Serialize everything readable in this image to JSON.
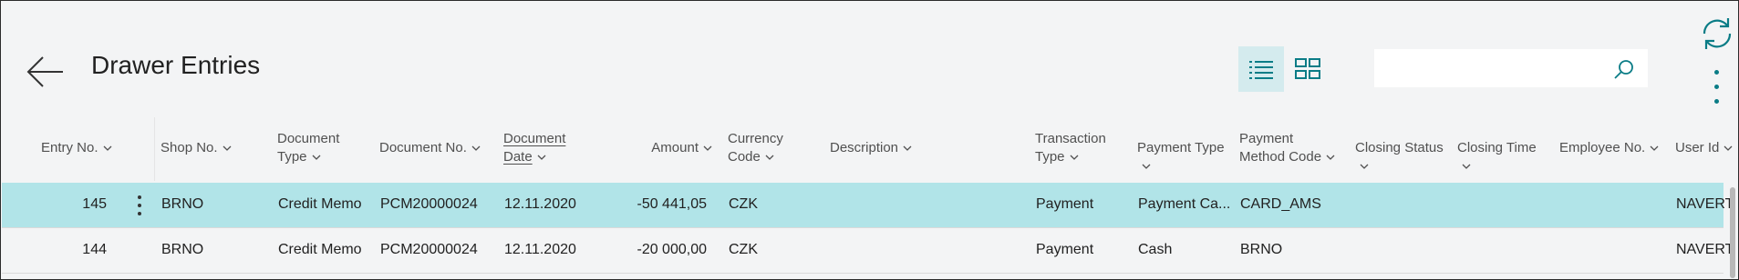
{
  "page": {
    "title": "Drawer Entries"
  },
  "search": {
    "value": "",
    "placeholder": ""
  },
  "columns": [
    {
      "key": "entry_no",
      "line1": "Entry No.",
      "line2": ""
    },
    {
      "key": "shop_no",
      "line1": "Shop No.",
      "line2": ""
    },
    {
      "key": "document_type",
      "line1": "Document",
      "line2": "Type"
    },
    {
      "key": "document_no",
      "line1": "Document No.",
      "line2": ""
    },
    {
      "key": "document_date",
      "line1": "Document",
      "line2": "Date"
    },
    {
      "key": "amount",
      "line1": "Amount",
      "line2": ""
    },
    {
      "key": "currency_code",
      "line1": "Currency",
      "line2": "Code"
    },
    {
      "key": "description",
      "line1": "Description",
      "line2": ""
    },
    {
      "key": "transaction_type",
      "line1": "Transaction",
      "line2": "Type"
    },
    {
      "key": "payment_type",
      "line1": "Payment Type",
      "line2": ""
    },
    {
      "key": "payment_method_code",
      "line1": "Payment",
      "line2": "Method Code"
    },
    {
      "key": "closing_status",
      "line1": "Closing Status",
      "line2": ""
    },
    {
      "key": "closing_time",
      "line1": "Closing Time",
      "line2": ""
    },
    {
      "key": "employee_no",
      "line1": "Employee No.",
      "line2": ""
    },
    {
      "key": "user_id",
      "line1": "User Id",
      "line2": ""
    }
  ],
  "rows": [
    {
      "entry_no": "145",
      "shop_no": "BRNO",
      "document_type": "Credit Memo",
      "document_no": "PCM20000024",
      "document_date": "12.11.2020",
      "amount": "-50 441,05",
      "currency_code": "CZK",
      "transaction_type": "Payment",
      "payment_type": "Payment Ca...",
      "payment_method_code": "CARD_AMS",
      "user_id": "NAVERT",
      "selected": true
    },
    {
      "entry_no": "144",
      "shop_no": "BRNO",
      "document_type": "Credit Memo",
      "document_no": "PCM20000024",
      "document_date": "12.11.2020",
      "amount": "-20 000,00",
      "currency_code": "CZK",
      "transaction_type": "Payment",
      "payment_type": "Cash",
      "payment_method_code": "BRNO",
      "user_id": "NAVERT",
      "selected": false
    }
  ],
  "colors": {
    "accent": "#0a7c86",
    "selected_row": "#b1e4e8",
    "active_view": "#d4ebee",
    "background": "#f3f4f5"
  },
  "icons": [
    "back-arrow-icon",
    "list-view-icon",
    "tile-view-icon",
    "search-icon",
    "refresh-icon",
    "more-options-icon",
    "row-menu-icon",
    "chevron-down-icon"
  ]
}
